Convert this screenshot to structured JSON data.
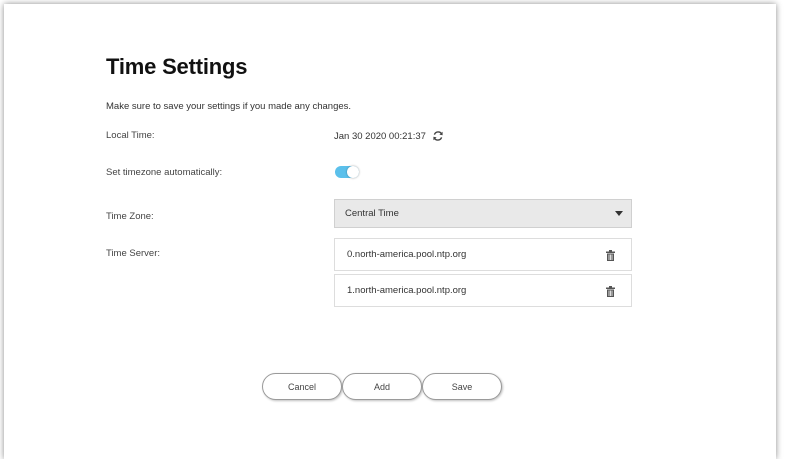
{
  "page": {
    "title": "Time Settings",
    "subtitle": "Make sure to save your settings if you made any changes."
  },
  "local_time": {
    "label": "Local Time:",
    "value": "Jan 30 2020 00:21:37",
    "refresh_icon": "refresh-icon"
  },
  "auto_timezone": {
    "label": "Set timezone automatically:",
    "enabled": true,
    "color": "#5bc0eb"
  },
  "timezone": {
    "label": "Time Zone:",
    "selected": "Central Time"
  },
  "time_server": {
    "label": "Time Server:",
    "servers": [
      "0.north-america.pool.ntp.org",
      "1.north-america.pool.ntp.org"
    ],
    "delete_icon": "trash-icon"
  },
  "actions": {
    "cancel_label": "Cancel",
    "add_label": "Add",
    "save_label": "Save"
  }
}
